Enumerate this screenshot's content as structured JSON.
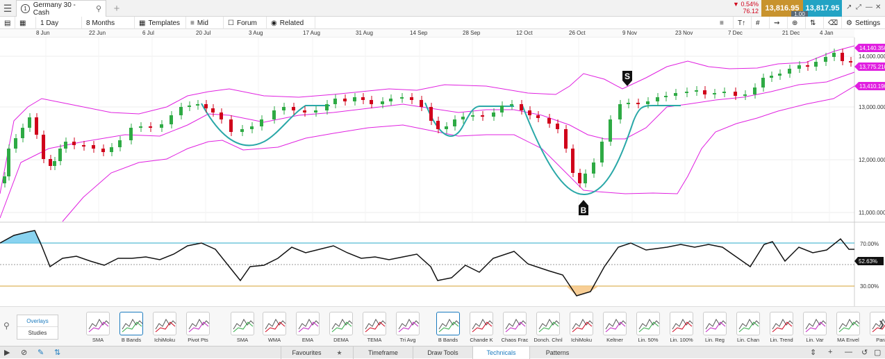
{
  "tab": {
    "title": "Germany 30 - Cash",
    "number": "1"
  },
  "quote": {
    "change_pct": "0.54%",
    "change_abs": "76.12",
    "sell": "13,816.95",
    "buy": "13,817.95",
    "spread": "1.00",
    "colors": {
      "sell": "#c8932e",
      "buy": "#22a3c4",
      "down": "#d0021b"
    }
  },
  "toolbar": {
    "interval": "1 Day",
    "range": "8 Months",
    "templates": "Templates",
    "price_type": "Mid",
    "forum": "Forum",
    "related": "Related",
    "settings": "Settings"
  },
  "date_labels": [
    "8 Jun",
    "22 Jun",
    "6 Jul",
    "20 Jul",
    "3 Aug",
    "17 Aug",
    "31 Aug",
    "14 Sep",
    "28 Sep",
    "12 Oct",
    "26 Oct",
    "9 Nov",
    "23 Nov",
    "7 Dec",
    "21 Dec",
    "4 Jan"
  ],
  "price_axis": {
    "labels": [
      "14,000.000",
      "13,000.000",
      "12,000.000",
      "11,000.000"
    ],
    "badges": [
      "14,140.350",
      "13,775.210",
      "13,410.190"
    ],
    "badge_color": "#e020e0"
  },
  "rsi_axis": {
    "labels": [
      "70.00%",
      "30.00%"
    ],
    "current": "52.63%",
    "upper_level": 70,
    "lower_level": 30
  },
  "markers": {
    "sell": "S",
    "buy": "B"
  },
  "chart_data": {
    "type": "candlestick",
    "x_range": [
      "2020-05-28",
      "2021-01-08"
    ],
    "ylim": [
      10800,
      14250
    ],
    "series": [
      {
        "name": "Price",
        "description": "daily candles rising from ~11,600 to ~14,100"
      }
    ],
    "overlays": [
      "Bollinger Bands",
      "pattern curves"
    ],
    "rsi_ylim": [
      0,
      100
    ]
  },
  "bottom": {
    "overlays": "Overlays",
    "studies": "Studies",
    "indicators": [
      {
        "label": "SMA"
      },
      {
        "label": "B Bands",
        "selected": true
      },
      {
        "label": "IchiMoku"
      },
      {
        "label": "Pivot Pts"
      },
      {
        "label": "SMA"
      },
      {
        "label": "WMA"
      },
      {
        "label": "EMA"
      },
      {
        "label": "DEMA"
      },
      {
        "label": "TEMA"
      },
      {
        "label": "Tri Avg"
      },
      {
        "label": "B Bands",
        "selected": true
      },
      {
        "label": "Chande K"
      },
      {
        "label": "Chaos Frac"
      },
      {
        "label": "Donch. Chnl"
      },
      {
        "label": "IchiMoku"
      },
      {
        "label": "Keltner"
      },
      {
        "label": "Lin. 50%"
      },
      {
        "label": "Lin. 100%"
      },
      {
        "label": "Lin. Reg"
      },
      {
        "label": "Lin. Chan"
      },
      {
        "label": "Lin. Trend"
      },
      {
        "label": "Lin. Var"
      },
      {
        "label": "MA Envel"
      },
      {
        "label": "Para"
      }
    ]
  },
  "footer": {
    "tabs": [
      "Favourites",
      "Timeframe",
      "Draw Tools",
      "Technicals",
      "Patterns"
    ],
    "active": "Technicals"
  }
}
